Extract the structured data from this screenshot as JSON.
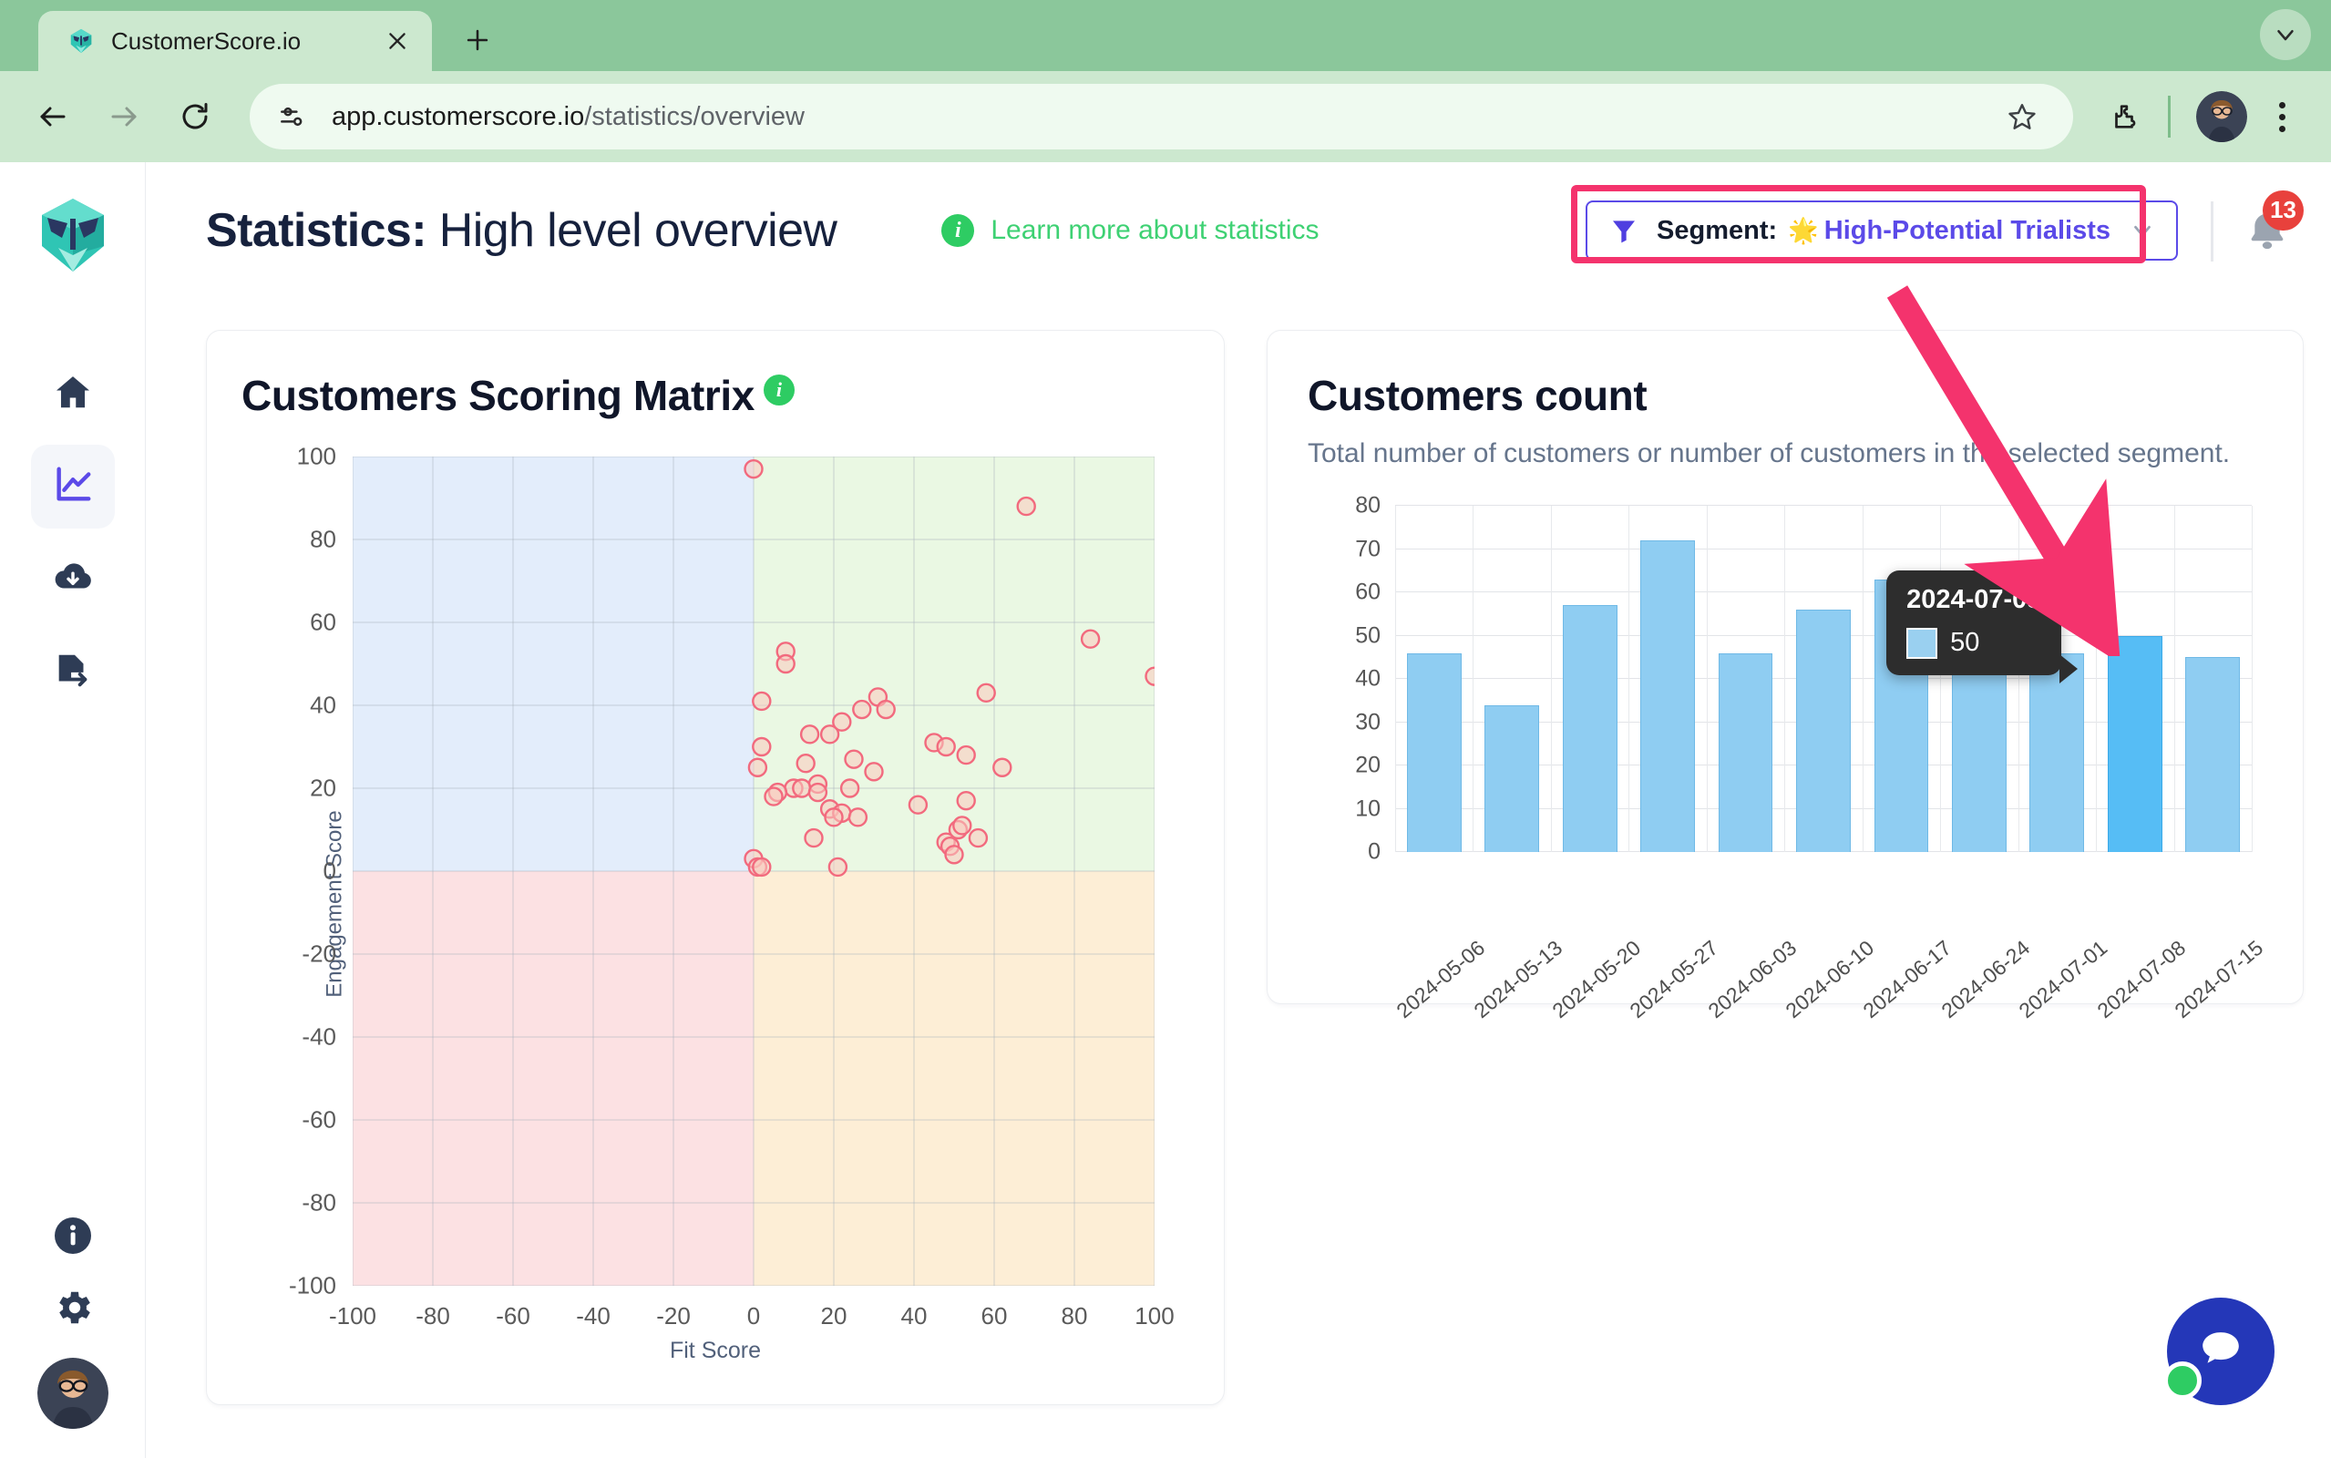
{
  "browser": {
    "tab": {
      "title": "CustomerScore.io",
      "favicon_icon": "knight-helmet-favicon",
      "close_icon": "close-icon"
    },
    "new_tab_label": "+",
    "tabstrip_menu_icon": "chevron-down-icon",
    "back_icon": "back-arrow-icon",
    "forward_icon": "forward-arrow-icon",
    "reload_icon": "reload-icon",
    "site_info_icon": "site-settings-icon",
    "url_main": "app.customerscore.io",
    "url_path": "/statistics/overview",
    "bookmark_icon": "star-icon",
    "extensions_icon": "puzzle-piece-icon",
    "profile_icon": "profile-avatar",
    "menu_icon": "three-dot-menu-icon"
  },
  "sidebar": {
    "logo_name": "customerscore-logo",
    "items": [
      {
        "name": "home",
        "icon": "home-icon",
        "active": false
      },
      {
        "name": "statistics",
        "icon": "line-chart-icon",
        "active": true
      },
      {
        "name": "import",
        "icon": "cloud-download-icon",
        "active": false
      },
      {
        "name": "export",
        "icon": "file-export-icon",
        "active": false
      }
    ],
    "bottom_items": [
      {
        "name": "info",
        "icon": "info-circle-icon"
      },
      {
        "name": "settings",
        "icon": "gear-icon"
      },
      {
        "name": "account",
        "icon": "user-avatar"
      }
    ]
  },
  "header": {
    "title_bold": "Statistics:",
    "title_rest": " High level overview",
    "learn_more_label": "Learn more about statistics",
    "learn_more_icon": "info-circle-icon",
    "segment": {
      "filter_icon": "filter-funnel-icon",
      "label": "Segment:",
      "star": "🌟",
      "value": "High-Potential Trialists",
      "chevron_icon": "chevron-down-icon",
      "highlight_color": "#f4336d",
      "border_color": "#5b4ae8",
      "value_color": "#5b4ae8"
    },
    "notifications": {
      "icon": "bell-icon",
      "count": "13",
      "badge_color": "#e8413c"
    }
  },
  "annotation": {
    "arrow_icon": "pink-arrow-pointing-down",
    "color": "#f4336d"
  },
  "cards": {
    "scoring_matrix": {
      "title": "Customers Scoring Matrix",
      "info_icon": "info-circle-icon"
    },
    "customers_count": {
      "title": "Customers count",
      "subtitle": "Total number of customers or number of customers in the selected segment."
    }
  },
  "chat": {
    "icon": "chat-bubble-icon",
    "status": "online",
    "color": "#2437b8",
    "status_color": "#2ecc63"
  },
  "chart_data": [
    {
      "id": "scoring_matrix",
      "type": "scatter",
      "title": "Customers Scoring Matrix",
      "xlabel": "Fit Score",
      "ylabel": "Engagement Score",
      "xlim": [
        -100,
        100
      ],
      "ylim": [
        -100,
        100
      ],
      "xticks": [
        -100,
        -80,
        -60,
        -40,
        -20,
        0,
        20,
        40,
        60,
        80,
        100
      ],
      "yticks": [
        100,
        80,
        60,
        40,
        20,
        0,
        -20,
        -40,
        -60,
        -80,
        -100
      ],
      "grid": true,
      "legend": "none",
      "point_color": "#f26a7e",
      "quadrants": [
        {
          "name": "top-left",
          "color": "#e3edfb"
        },
        {
          "name": "top-right",
          "color": "#eaf8e3"
        },
        {
          "name": "bottom-left",
          "color": "#fce1e3"
        },
        {
          "name": "bottom-right",
          "color": "#fdeed6"
        }
      ],
      "points": [
        [
          0,
          97
        ],
        [
          68,
          88
        ],
        [
          8,
          53
        ],
        [
          8,
          50
        ],
        [
          84,
          56
        ],
        [
          100,
          47
        ],
        [
          2,
          41
        ],
        [
          58,
          43
        ],
        [
          31,
          42
        ],
        [
          27,
          39
        ],
        [
          33,
          39
        ],
        [
          22,
          36
        ],
        [
          14,
          33
        ],
        [
          19,
          33
        ],
        [
          45,
          31
        ],
        [
          48,
          30
        ],
        [
          2,
          30
        ],
        [
          53,
          28
        ],
        [
          1,
          25
        ],
        [
          13,
          26
        ],
        [
          25,
          27
        ],
        [
          62,
          25
        ],
        [
          30,
          24
        ],
        [
          24,
          20
        ],
        [
          16,
          21
        ],
        [
          10,
          20
        ],
        [
          12,
          20
        ],
        [
          6,
          19
        ],
        [
          16,
          19
        ],
        [
          5,
          18
        ],
        [
          41,
          16
        ],
        [
          53,
          17
        ],
        [
          19,
          15
        ],
        [
          22,
          14
        ],
        [
          20,
          13
        ],
        [
          26,
          13
        ],
        [
          51,
          10
        ],
        [
          52,
          11
        ],
        [
          56,
          8
        ],
        [
          48,
          7
        ],
        [
          49,
          6
        ],
        [
          15,
          8
        ],
        [
          50,
          4
        ],
        [
          0,
          3
        ],
        [
          1,
          1
        ],
        [
          2,
          1
        ],
        [
          21,
          1
        ]
      ]
    },
    {
      "id": "customers_count",
      "type": "bar",
      "title": "Customers count",
      "subtitle": "Total number of customers or number of customers in the selected segment.",
      "categories": [
        "2024-05-06",
        "2024-05-13",
        "2024-05-20",
        "2024-05-27",
        "2024-06-03",
        "2024-06-10",
        "2024-06-17",
        "2024-06-24",
        "2024-07-01",
        "2024-07-08",
        "2024-07-15"
      ],
      "values": [
        46,
        34,
        57,
        72,
        46,
        56,
        63,
        44,
        46,
        50,
        45
      ],
      "ylim": [
        0,
        80
      ],
      "yticks": [
        0,
        10,
        20,
        30,
        40,
        50,
        60,
        70,
        80
      ],
      "xlabel": "",
      "ylabel": "",
      "grid": true,
      "legend": "none",
      "bar_color": "#8fcdf2",
      "highlight_index": 9,
      "highlight_color": "#56bdf5",
      "tooltip": {
        "title": "2024-07-08",
        "value": "50",
        "swatch_color": "#9ad0f0"
      }
    }
  ]
}
